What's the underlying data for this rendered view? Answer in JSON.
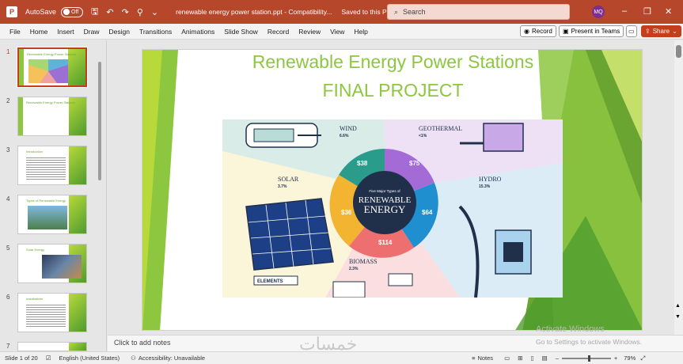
{
  "titlebar": {
    "app_logo": "P",
    "autosave_label": "AutoSave",
    "autosave_state": "Off",
    "doc_title": "renewable energy power station.ppt  -  Compatibility...",
    "saved_status": "Saved to this PC",
    "search_placeholder": "Search",
    "user_initials": "MQ"
  },
  "menu": [
    "File",
    "Home",
    "Insert",
    "Draw",
    "Design",
    "Transitions",
    "Animations",
    "Slide Show",
    "Record",
    "Review",
    "View",
    "Help"
  ],
  "ribbon_buttons": {
    "record": "Record",
    "present": "Present in Teams",
    "share": "Share"
  },
  "slides": [
    {
      "num": "1",
      "title": "Renewable Energy Power Stations"
    },
    {
      "num": "2",
      "title": "Renewable Energy Power Stations"
    },
    {
      "num": "3",
      "title": "Introduction"
    },
    {
      "num": "4",
      "title": "Types of Renewable Energy"
    },
    {
      "num": "5",
      "title": "Solar Energy"
    },
    {
      "num": "6",
      "title": "Installations"
    },
    {
      "num": "7",
      "title": ""
    }
  ],
  "slide": {
    "title_line1": "Renewable Energy Power Stations",
    "title_line2": "FINAL PROJECT"
  },
  "infographic": {
    "center_caption": "Five Major Types of",
    "center_big1": "RENEWABLE",
    "center_big2": "ENERGY",
    "brand": "ELEMENTS",
    "sections": [
      {
        "name": "WIND",
        "pct": "6.6%",
        "note": "global electricity generation (2021)",
        "value": "$38"
      },
      {
        "name": "GEOTHERMAL",
        "pct": "<1%",
        "note": "global electricity generation (2021)",
        "value": "$75"
      },
      {
        "name": "HYDRO",
        "pct": "15.3%",
        "note": "global electricity generation (2021)",
        "value": "$64"
      },
      {
        "name": "BIOMASS",
        "pct": "2.3%",
        "note": "global electricity generation (2021)",
        "value": "$114"
      },
      {
        "name": "SOLAR",
        "pct": "3.7%",
        "note": "global electricity generation (2021)",
        "value": "$36"
      }
    ]
  },
  "notes_placeholder": "Click to add notes",
  "activation": {
    "line1": "Activate Windows",
    "line2": "Go to Settings to activate Windows."
  },
  "watermark": "خمسات",
  "status": {
    "slide_of": "Slide 1 of 20",
    "language": "English (United States)",
    "accessibility": "Accessibility: Unavailable",
    "notes": "Notes",
    "zoom": "79%"
  }
}
